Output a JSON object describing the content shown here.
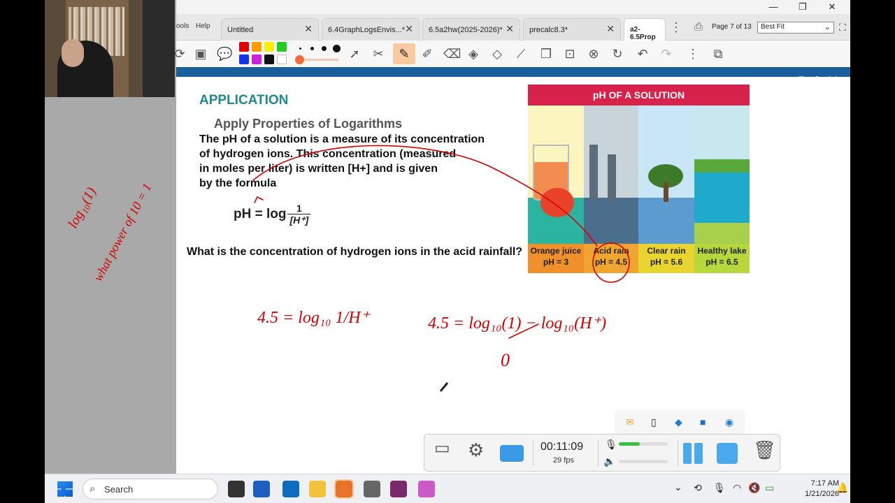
{
  "menu": {
    "tools_label": "ools",
    "help_label": "Help"
  },
  "tabs": [
    {
      "label": "Untitled"
    },
    {
      "label": "6.4GraphLogsEnvis...*"
    },
    {
      "label": "6.5a2hw(2025-2026)*"
    },
    {
      "label": "precalc8.3*"
    },
    {
      "label": "a2-6.5Prop"
    }
  ],
  "viewer": {
    "page_info": "Page 7 of 13",
    "zoom": "Best Fit"
  },
  "colors": {
    "accent_teal": "#1e8a8e",
    "header_blue": "#1b5f9a",
    "ink_red": "#d40000",
    "ph_banner": "#d7234b"
  },
  "doc": {
    "topic_tab": "Topic 6  Le",
    "section_title": "APPLICATION",
    "subtitle": "Apply Properties of Logarithms",
    "paragraph_lines": [
      "The pH of a solution is a measure of its concentration",
      "of hydrogen ions. This concentration (measured",
      "in moles per liter) is written [H+] and is given",
      "by the formula"
    ],
    "formula_lhs": "pH = log",
    "formula_num": "1",
    "formula_den": "[H⁺]",
    "question": "What is the concentration of hydrogen ions in the acid rainfall?"
  },
  "illustration": {
    "title": "pH OF A SOLUTION",
    "panels": [
      {
        "name": "Orange juice",
        "ph": "pH = 3"
      },
      {
        "name": "Acid rain",
        "ph": "pH = 4.5"
      },
      {
        "name": "Clear rain",
        "ph": "pH = 5.6"
      },
      {
        "name": "Healthy lake",
        "ph": "pH = 6.5"
      }
    ]
  },
  "handwriting": {
    "left_note_1": "log₁₀(1)",
    "left_note_2": "what power of 10 = 1",
    "eq1": "4.5 = log₁₀ 1/H⁺",
    "eq2": "4.5 = log₁₀(1) − log₁₀(H⁺)",
    "zero": "0"
  },
  "recorder": {
    "time": "00:11:09",
    "fps": "29 fps"
  },
  "taskbar": {
    "search_placeholder": "Search",
    "time": "7:17 AM",
    "date": "1/21/2026"
  }
}
